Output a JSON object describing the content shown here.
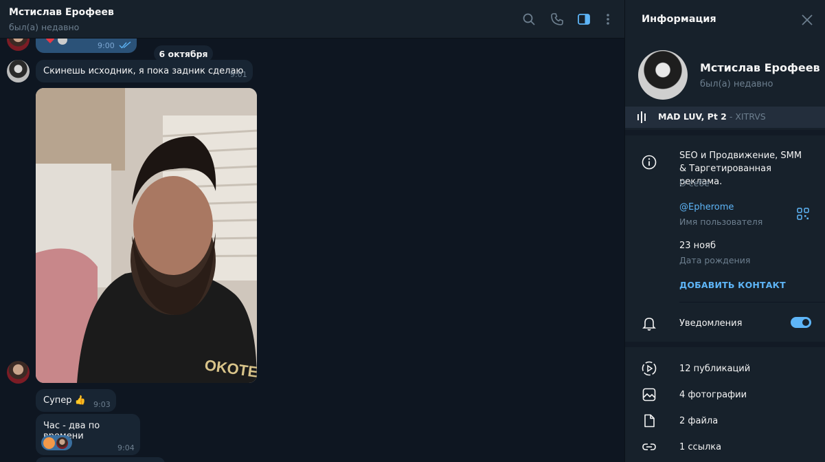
{
  "chat": {
    "title": "Мстислав Ерофеев",
    "status": "был(а) недавно",
    "date_separator": "6 октября",
    "messages": [
      {
        "text": "",
        "time": "9:00",
        "outgoing": true
      },
      {
        "text": "Скинешь исходник, я пока задник сделаю",
        "time": "9:01"
      },
      {
        "text": "Супер 👍",
        "time": "9:03"
      },
      {
        "text": "Час - два по времени",
        "time": "9:04"
      }
    ]
  },
  "header_icons": [
    "search-icon",
    "phone-icon",
    "sidebar-toggle-icon",
    "more-icon"
  ],
  "info": {
    "title": "Информация",
    "name": "Мстислав Ерофеев",
    "status": "был(а) недавно",
    "music": {
      "title": "MAD LUV, Pt 2",
      "artist": " - XITRVS"
    },
    "bio": "SEO и Продвижение, SMM & Таргетированная реклама.",
    "bio_label": "О себе",
    "username": "@Epherome",
    "username_label": "Имя пользователя",
    "birthday": "23 нояб",
    "birthday_label": "Дата рождения",
    "add_contact": "ДОБАВИТЬ КОНТАКТ",
    "notifications": "Уведомления",
    "notifications_on": true,
    "media": [
      {
        "label": "12 публикаций",
        "icon": "stories-icon"
      },
      {
        "label": "4 фотографии",
        "icon": "photo-icon"
      },
      {
        "label": "2 файла",
        "icon": "file-icon"
      },
      {
        "label": "1 ссылка",
        "icon": "link-icon"
      }
    ]
  },
  "colors": {
    "background": "#0e1621",
    "panel": "#17212b",
    "bubble_in": "#182533",
    "bubble_out": "#2b5278",
    "accent": "#5eb5f7",
    "muted": "#6d7f8f"
  }
}
